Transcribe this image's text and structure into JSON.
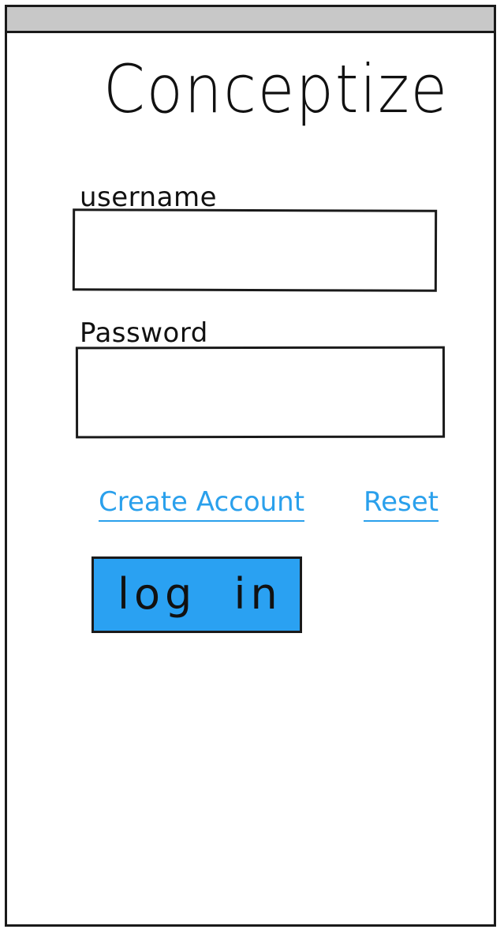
{
  "app": {
    "title": "Conceptize"
  },
  "form": {
    "username_label": "username",
    "username_value": "",
    "password_label": "Password",
    "password_value": ""
  },
  "links": {
    "create_account": "Create Account",
    "reset": "Reset"
  },
  "buttons": {
    "login_label": "log in"
  },
  "colors": {
    "accent": "#2aa1f2",
    "link": "#2aa0ec",
    "status_bar": "#c8c8c8",
    "stroke": "#1a1a1a"
  }
}
